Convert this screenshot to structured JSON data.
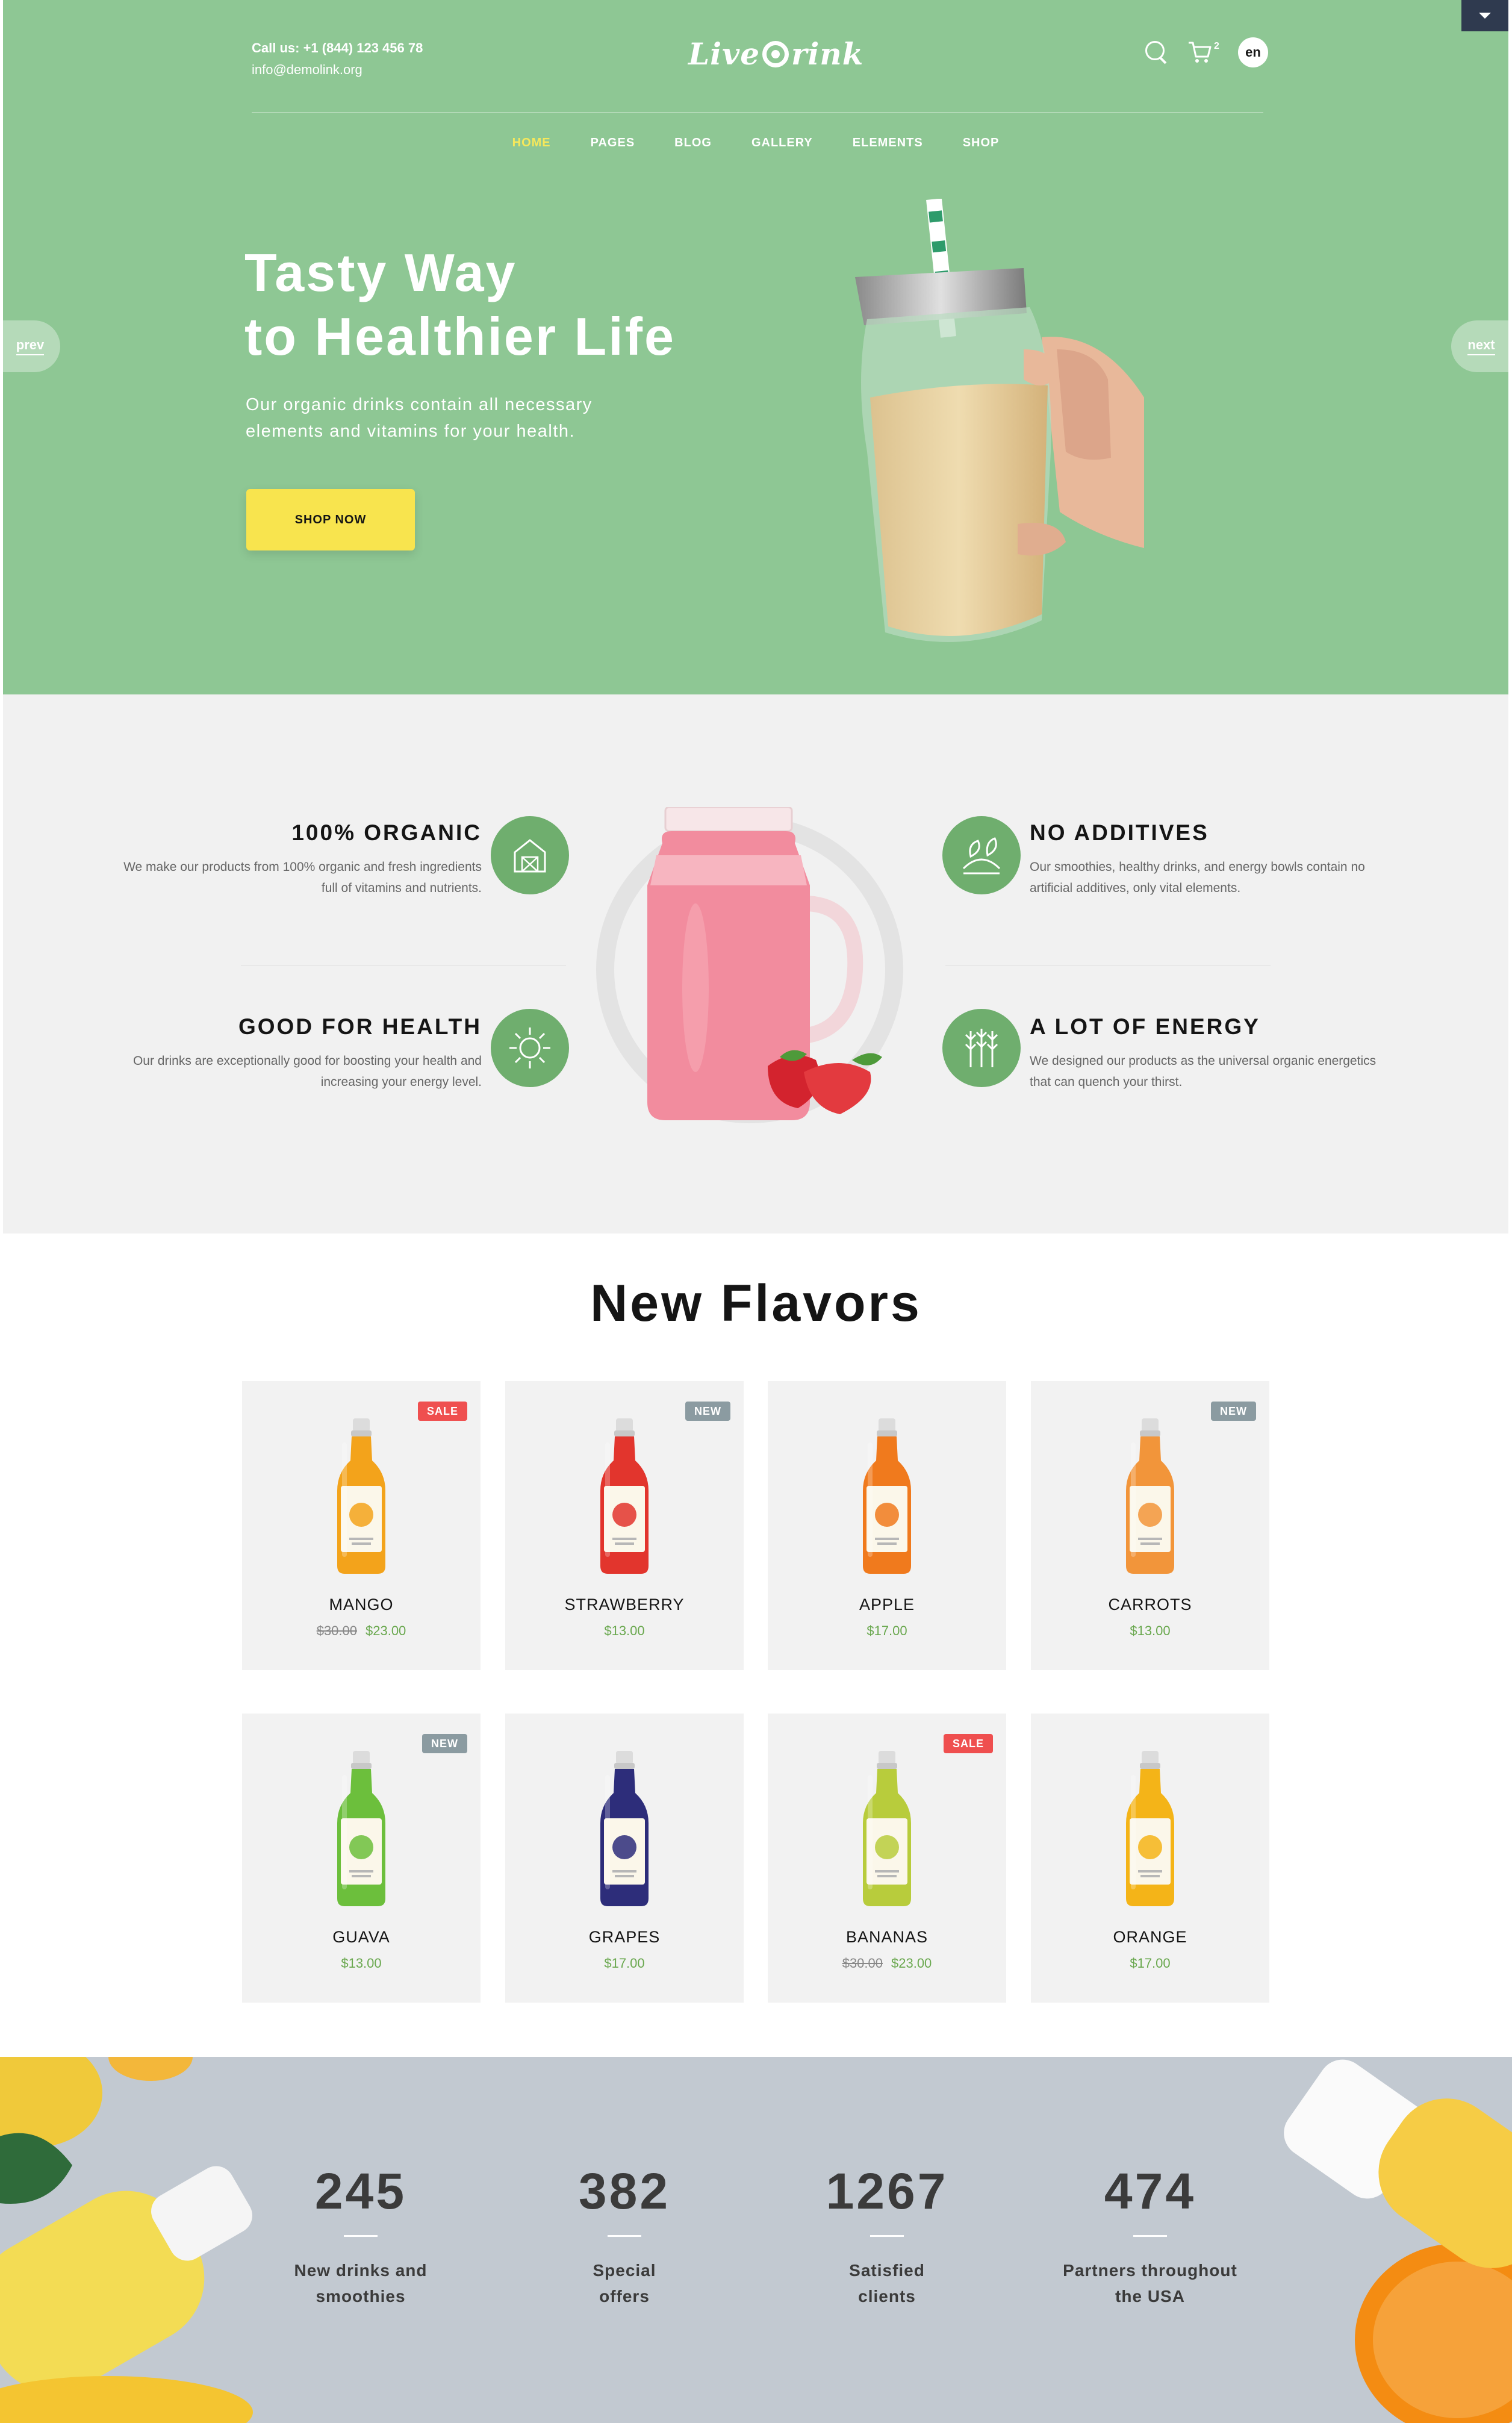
{
  "header": {
    "phone": "Call us: +1 (844) 123 456 78",
    "email": "info@demolink.org",
    "logo_left": "Live",
    "logo_right": "rink",
    "cart_count": "2",
    "lang": "en"
  },
  "nav": {
    "items": [
      {
        "label": "HOME",
        "active": true
      },
      {
        "label": "PAGES"
      },
      {
        "label": "BLOG"
      },
      {
        "label": "GALLERY"
      },
      {
        "label": "ELEMENTS"
      },
      {
        "label": "SHOP"
      }
    ]
  },
  "hero": {
    "title_line1": "Tasty Way",
    "title_line2": "to Healthier Life",
    "text": "Our organic drinks contain all necessary elements and vitamins for your health.",
    "button": "SHOP NOW",
    "prev": "prev",
    "next": "next"
  },
  "features": {
    "organic": {
      "title": "100% ORGANIC",
      "desc": "We make our products from 100% organic and fresh ingredients full of vitamins and nutrients.",
      "icon": "barn-icon"
    },
    "health": {
      "title": "GOOD FOR HEALTH",
      "desc": "Our drinks are exceptionally good for boosting your health and increasing your energy level.",
      "icon": "sun-icon"
    },
    "additives": {
      "title": "NO ADDITIVES",
      "desc": "Our smoothies, healthy drinks, and energy bowls contain no artificial additives, only vital elements.",
      "icon": "leaves-icon"
    },
    "energy": {
      "title": "A LOT OF ENERGY",
      "desc": "We designed our products as the universal organic energetics that can quench your thirst.",
      "icon": "wheat-icon"
    }
  },
  "flavors": {
    "title": "New Flavors",
    "products": [
      {
        "name": "MANGO",
        "old_price": "$30.00",
        "price": "$23.00",
        "badge": "SALE",
        "color": "#f3a31b"
      },
      {
        "name": "STRAWBERRY",
        "old_price": "",
        "price": "$13.00",
        "badge": "NEW",
        "color": "#e2352d"
      },
      {
        "name": "APPLE",
        "old_price": "",
        "price": "$17.00",
        "badge": "",
        "color": "#f07a1d"
      },
      {
        "name": "CARROTS",
        "old_price": "",
        "price": "$13.00",
        "badge": "NEW",
        "color": "#f2953a"
      },
      {
        "name": "GUAVA",
        "old_price": "",
        "price": "$13.00",
        "badge": "NEW",
        "color": "#6cbf3c"
      },
      {
        "name": "GRAPES",
        "old_price": "",
        "price": "$17.00",
        "badge": "",
        "color": "#2d2d7a"
      },
      {
        "name": "BANANAS",
        "old_price": "$30.00",
        "price": "$23.00",
        "badge": "SALE",
        "color": "#b8cc3c"
      },
      {
        "name": "ORANGE",
        "old_price": "",
        "price": "$17.00",
        "badge": "",
        "color": "#f4b418"
      }
    ]
  },
  "stats": [
    {
      "num": "245",
      "label1": "New drinks and",
      "label2": "smoothies"
    },
    {
      "num": "382",
      "label1": "Special",
      "label2": "offers"
    },
    {
      "num": "1267",
      "label1": "Satisfied",
      "label2": "clients"
    },
    {
      "num": "474",
      "label1": "Partners throughout",
      "label2": "the USA"
    }
  ]
}
